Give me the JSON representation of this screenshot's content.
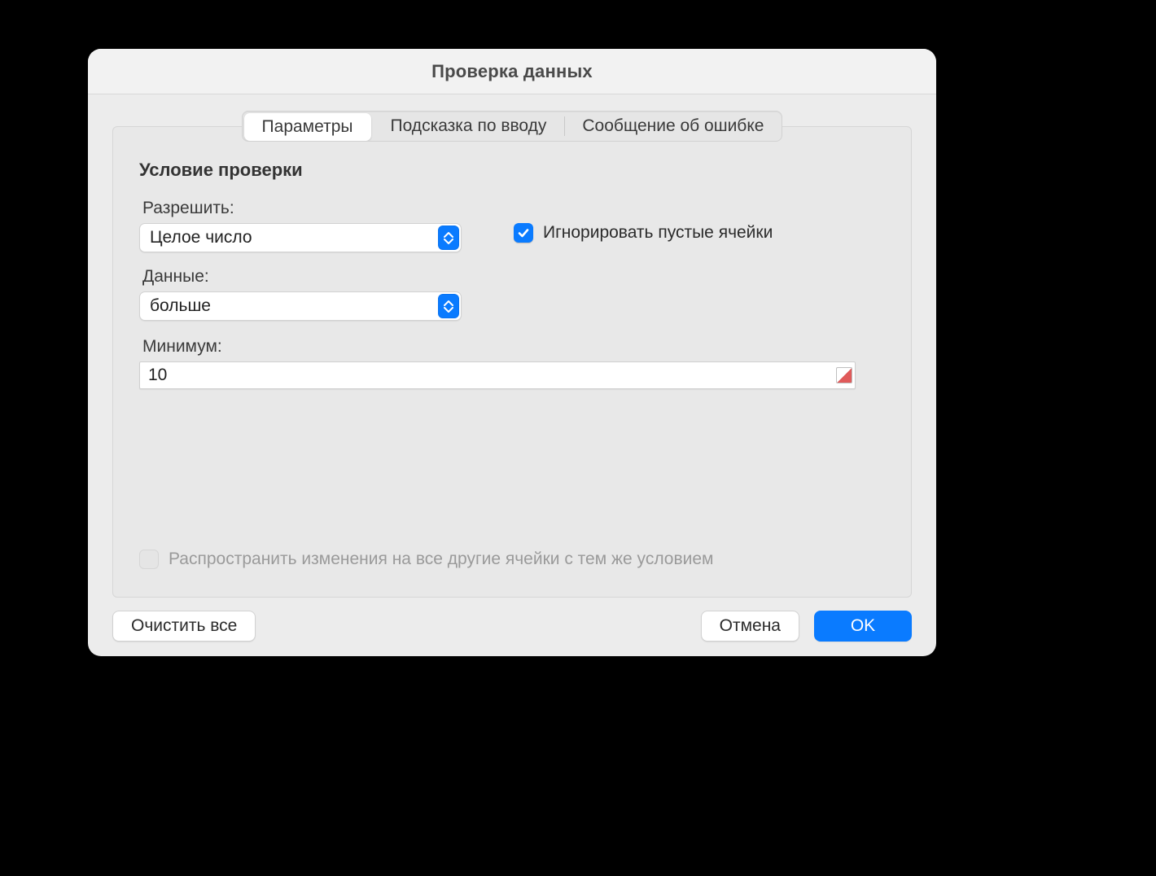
{
  "window": {
    "title": "Проверка данных"
  },
  "tabs": {
    "items": [
      {
        "label": "Параметры",
        "active": true
      },
      {
        "label": "Подсказка по вводу",
        "active": false
      },
      {
        "label": "Сообщение об ошибке",
        "active": false
      }
    ]
  },
  "section": {
    "title": "Условие проверки"
  },
  "form": {
    "allow_label": "Разрешить:",
    "allow_value": "Целое число",
    "data_label": "Данные:",
    "data_value": "больше",
    "min_label": "Минимум:",
    "min_value": "10",
    "ignore_blank_label": "Игнорировать пустые ячейки",
    "ignore_blank_checked": true,
    "spread_label": "Распространить изменения на все другие ячейки с тем же условием",
    "spread_checked": false,
    "spread_enabled": false
  },
  "footer": {
    "clear_all": "Очистить все",
    "cancel": "Отмена",
    "ok": "OK"
  }
}
